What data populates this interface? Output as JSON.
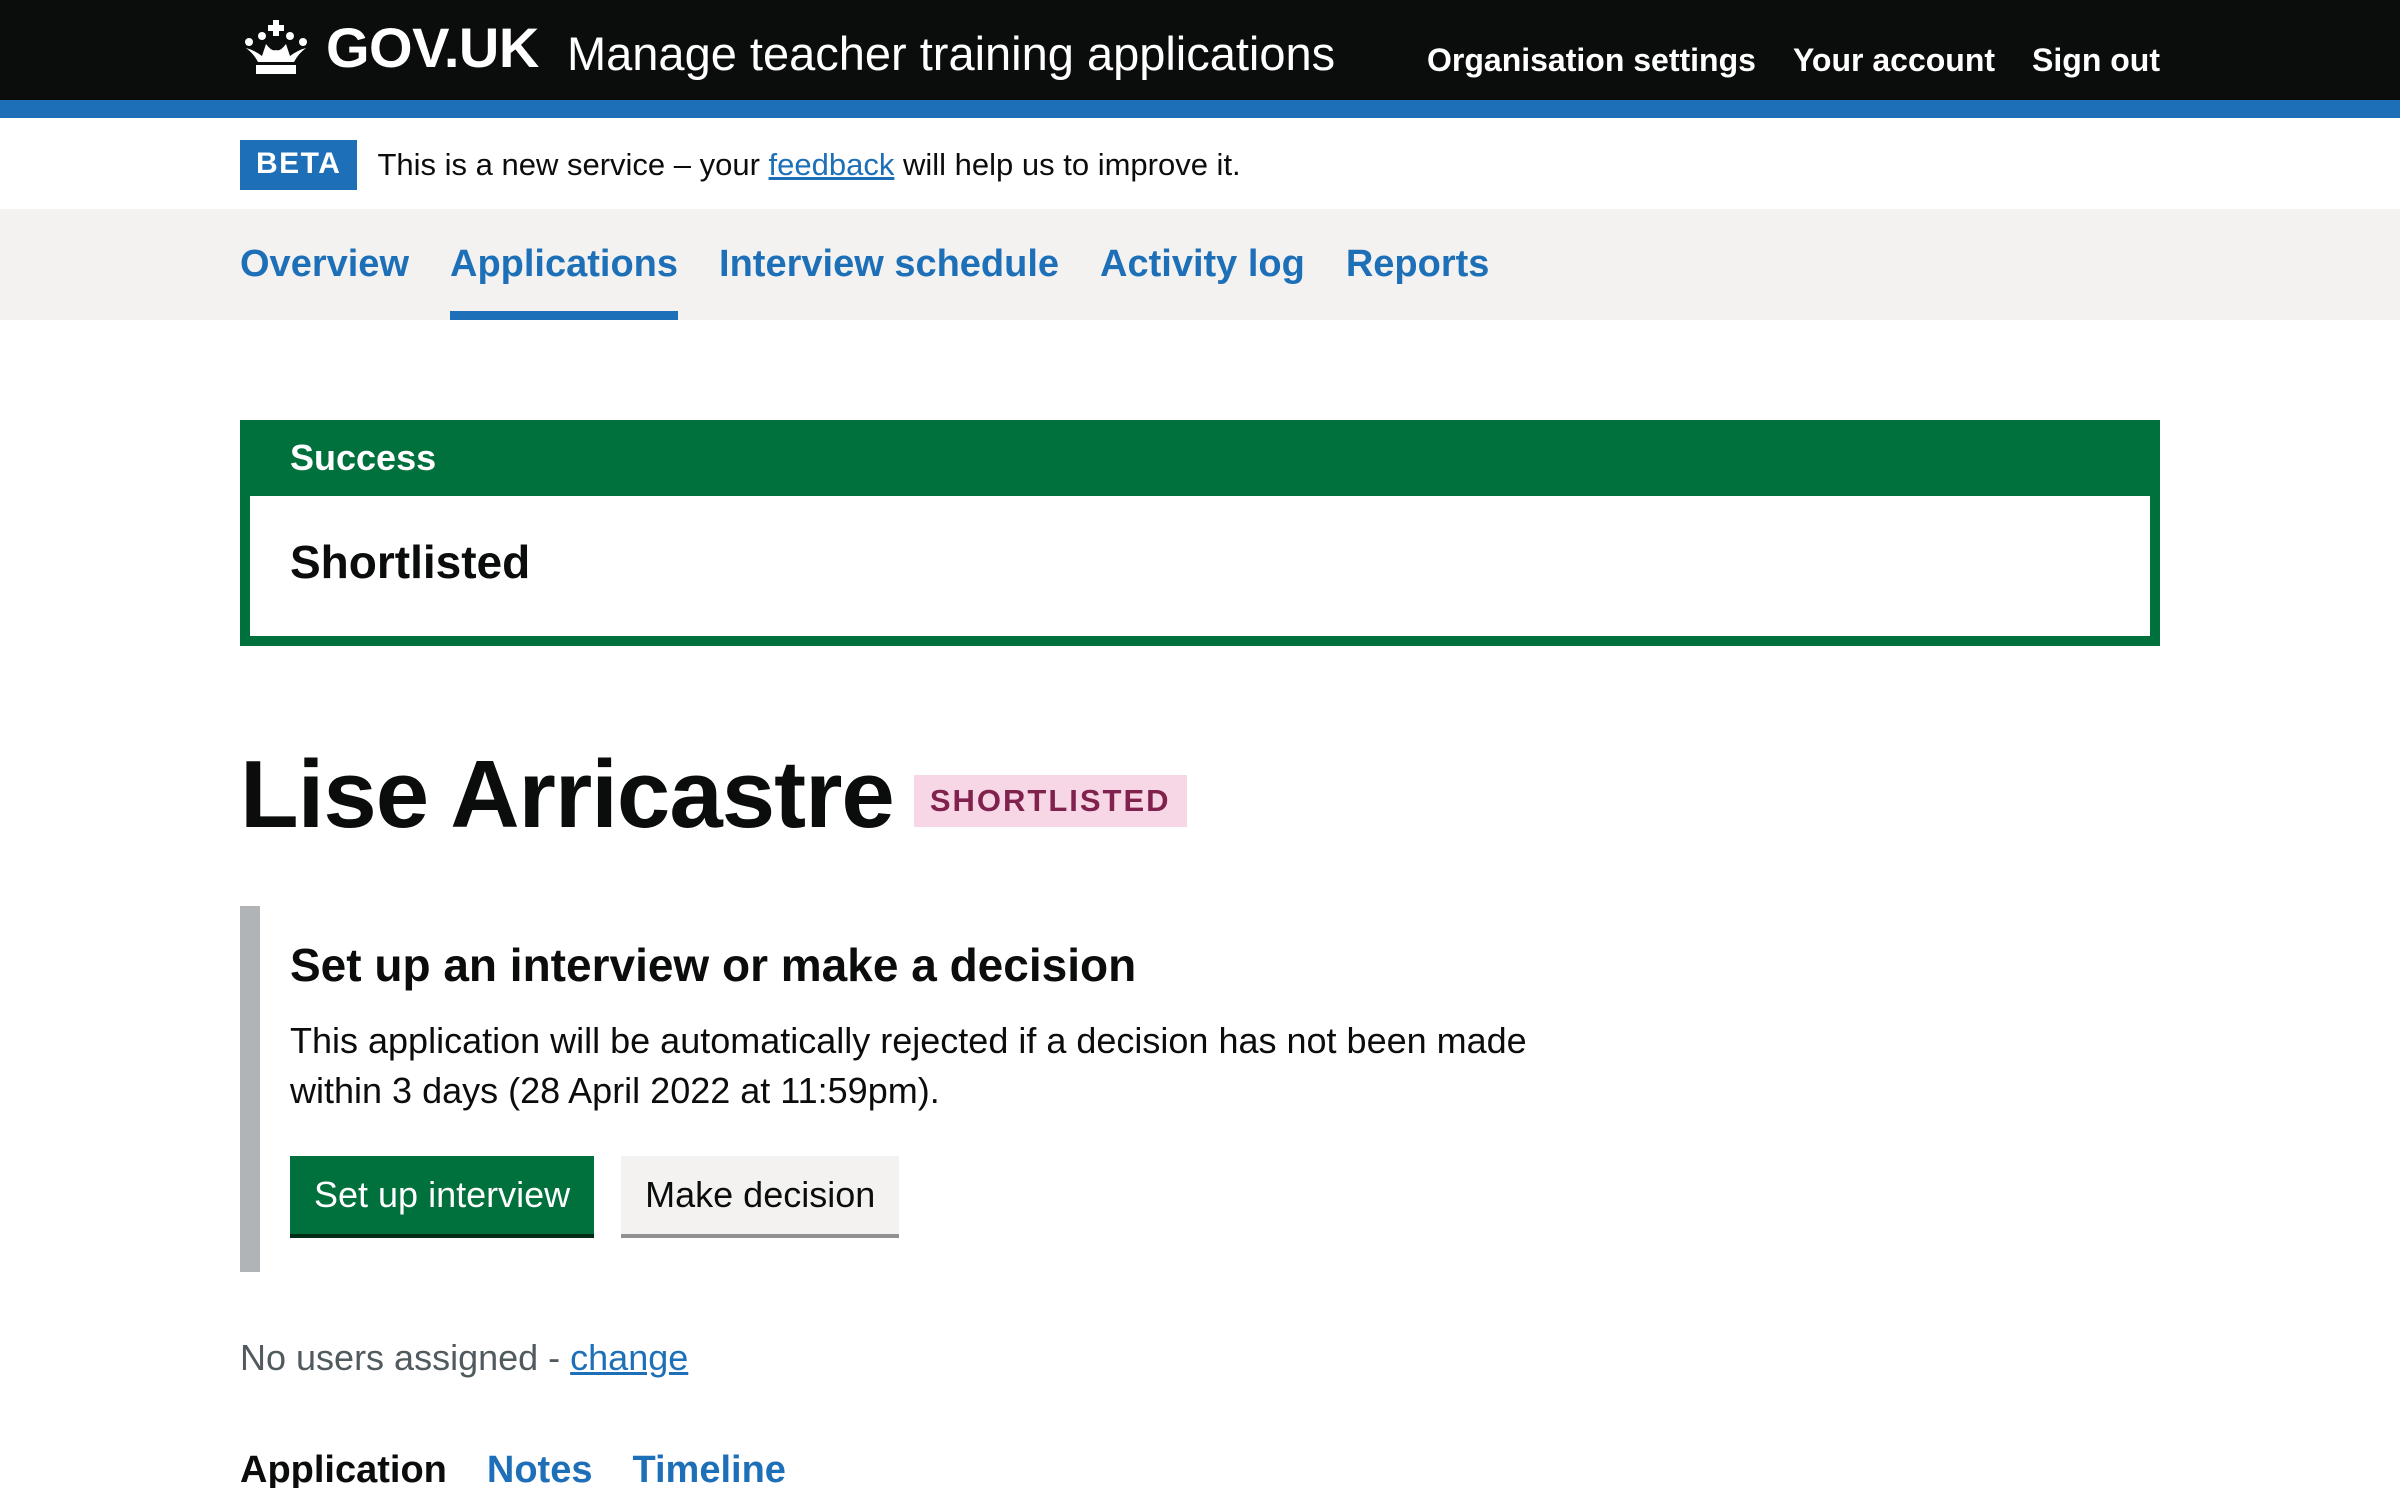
{
  "header": {
    "logo_text": "GOV.UK",
    "service_name": "Manage teacher training applications",
    "nav": [
      "Organisation settings",
      "Your account",
      "Sign out"
    ]
  },
  "phase_banner": {
    "tag": "BETA",
    "text_before": "This is a new service – your ",
    "link": "feedback",
    "text_after": " will help us to improve it."
  },
  "subnav": {
    "items": [
      "Overview",
      "Applications",
      "Interview schedule",
      "Activity log",
      "Reports"
    ],
    "current": "Applications"
  },
  "notification": {
    "title": "Success",
    "heading": "Shortlisted"
  },
  "candidate": {
    "name": "Lise Arricastre",
    "status": "SHORTLISTED"
  },
  "inset": {
    "heading": "Set up an interview or make a decision",
    "body": "This application will be automatically rejected if a decision has not been made within 3 days (28 April 2022 at 11:59pm).",
    "primary_button": "Set up interview",
    "secondary_button": "Make decision"
  },
  "assignment": {
    "text": "No users assigned - ",
    "link": "change"
  },
  "tabs": {
    "items": [
      "Application",
      "Notes",
      "Timeline"
    ],
    "current": "Application"
  },
  "colors": {
    "brand_blue": "#1d70b8",
    "success_green": "#00703c",
    "header_black": "#0b0c0c",
    "tag_pink_bg": "#f7d7e6",
    "tag_pink_text": "#80224d"
  }
}
